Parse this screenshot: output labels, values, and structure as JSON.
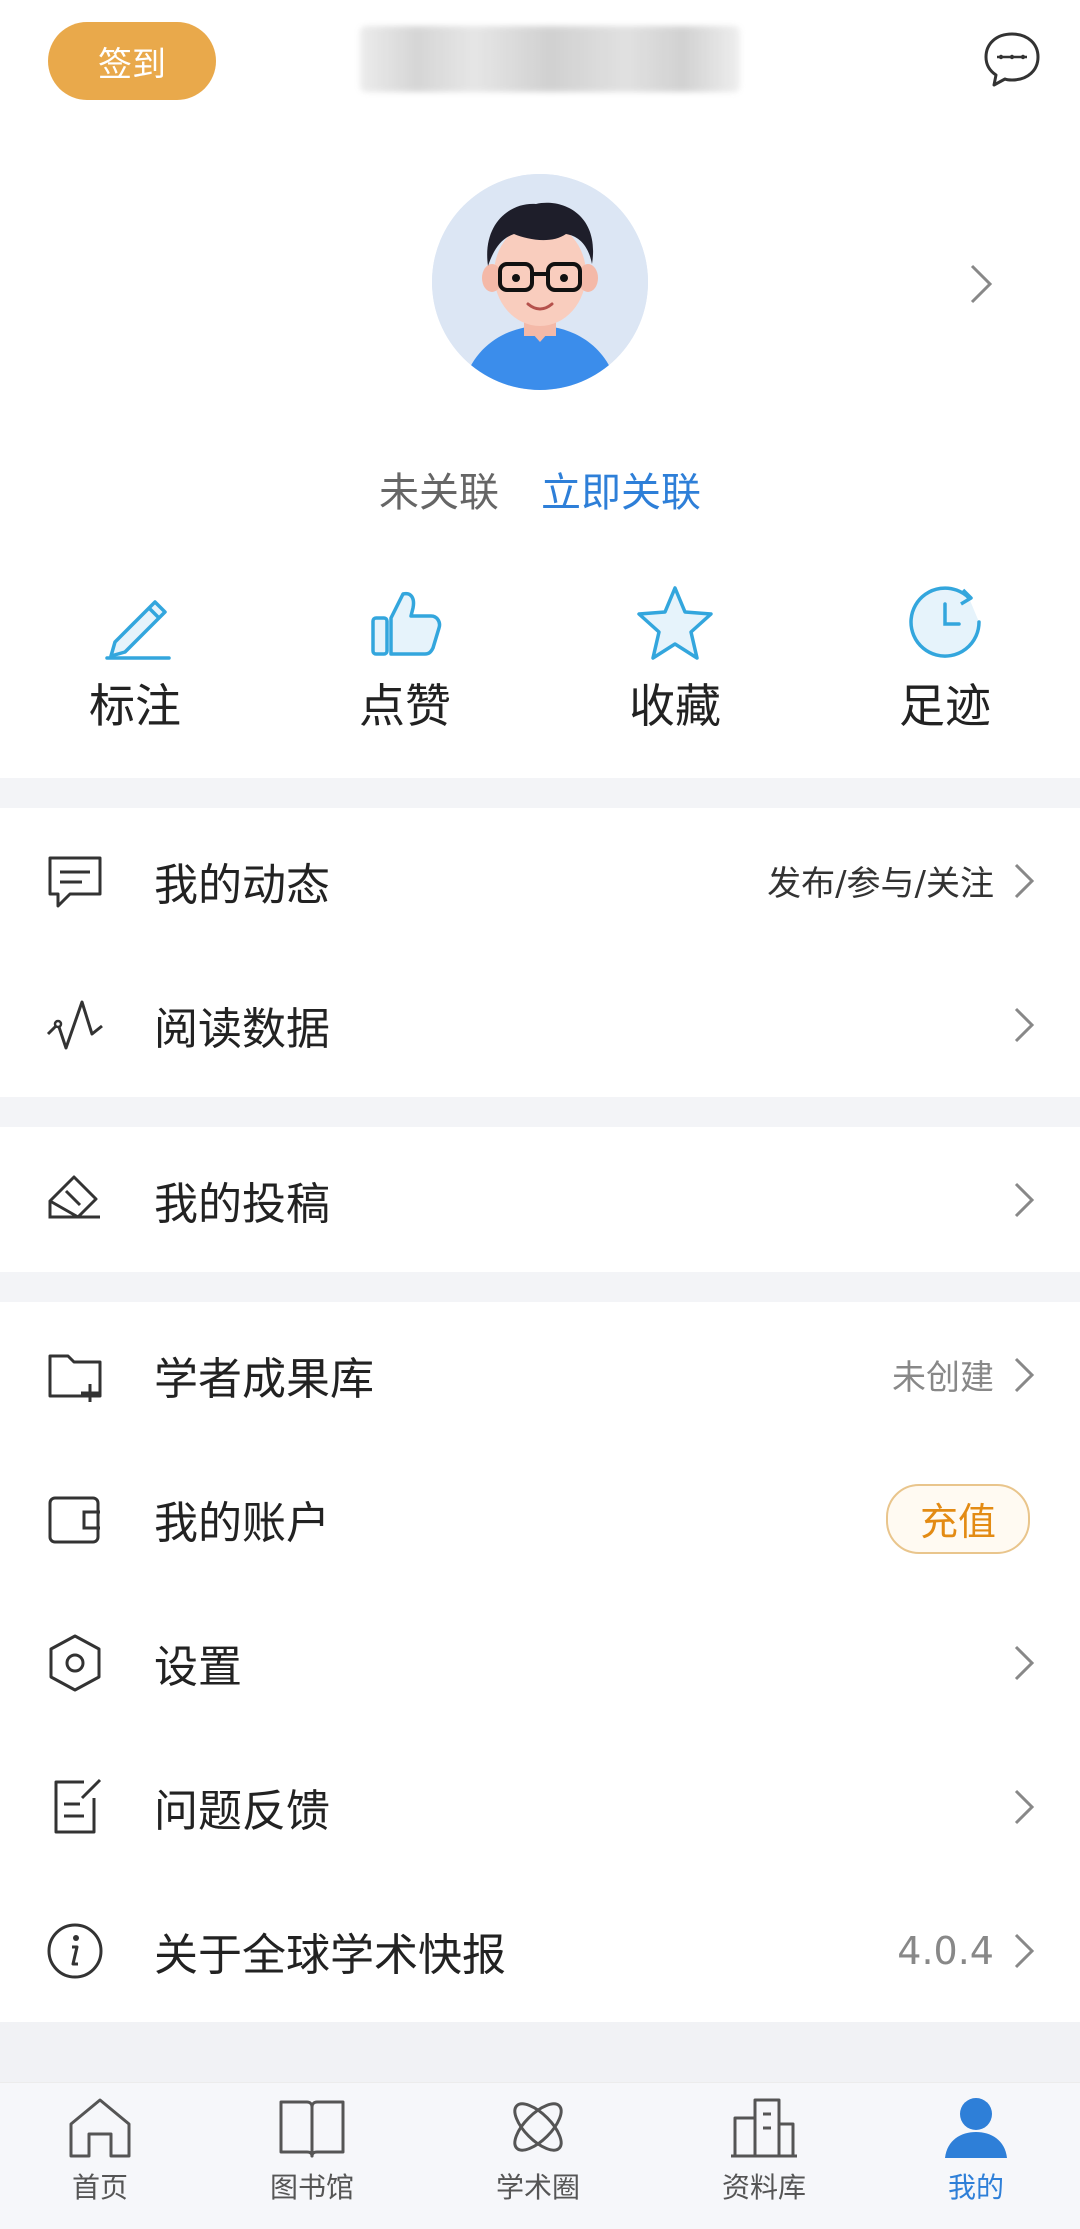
{
  "header": {
    "checkin_label": "签到",
    "username_blurred": true,
    "message_icon": "chat-bubble-icon"
  },
  "profile": {
    "avatar": "cartoon-avatar",
    "status": "未关联",
    "link_action": "立即关联"
  },
  "quick_actions": [
    {
      "icon": "pencil-icon",
      "label": "标注"
    },
    {
      "icon": "thumbs-up-icon",
      "label": "点赞"
    },
    {
      "icon": "star-icon",
      "label": "收藏"
    },
    {
      "icon": "clock-icon",
      "label": "足迹"
    }
  ],
  "menu": {
    "my_dynamics": {
      "icon": "comment-icon",
      "label": "我的动态",
      "right": "发布/参与/关注"
    },
    "reading_data": {
      "icon": "wave-icon",
      "label": "阅读数据"
    },
    "my_submissions": {
      "icon": "envelope-pen-icon",
      "label": "我的投稿"
    },
    "scholar_library": {
      "icon": "folder-add-icon",
      "label": "学者成果库",
      "right": "未创建"
    },
    "my_account": {
      "icon": "wallet-icon",
      "label": "我的账户",
      "action": "充值"
    },
    "settings": {
      "icon": "hexagon-settings-icon",
      "label": "设置"
    },
    "feedback": {
      "icon": "edit-note-icon",
      "label": "问题反馈"
    },
    "about": {
      "icon": "info-icon",
      "label": "关于全球学术快报",
      "right": "4.0.4"
    }
  },
  "bottom_nav": [
    {
      "icon": "home-icon",
      "label": "首页",
      "active": false
    },
    {
      "icon": "book-icon",
      "label": "图书馆",
      "active": false
    },
    {
      "icon": "atom-icon",
      "label": "学术圈",
      "active": false
    },
    {
      "icon": "buildings-icon",
      "label": "资料库",
      "active": false
    },
    {
      "icon": "person-icon",
      "label": "我的",
      "active": true
    }
  ],
  "colors": {
    "accent_blue": "#2E7FD8",
    "checkin_orange": "#E9A94B",
    "recharge_orange": "#E38B14",
    "separator": "#F3F4F7"
  }
}
